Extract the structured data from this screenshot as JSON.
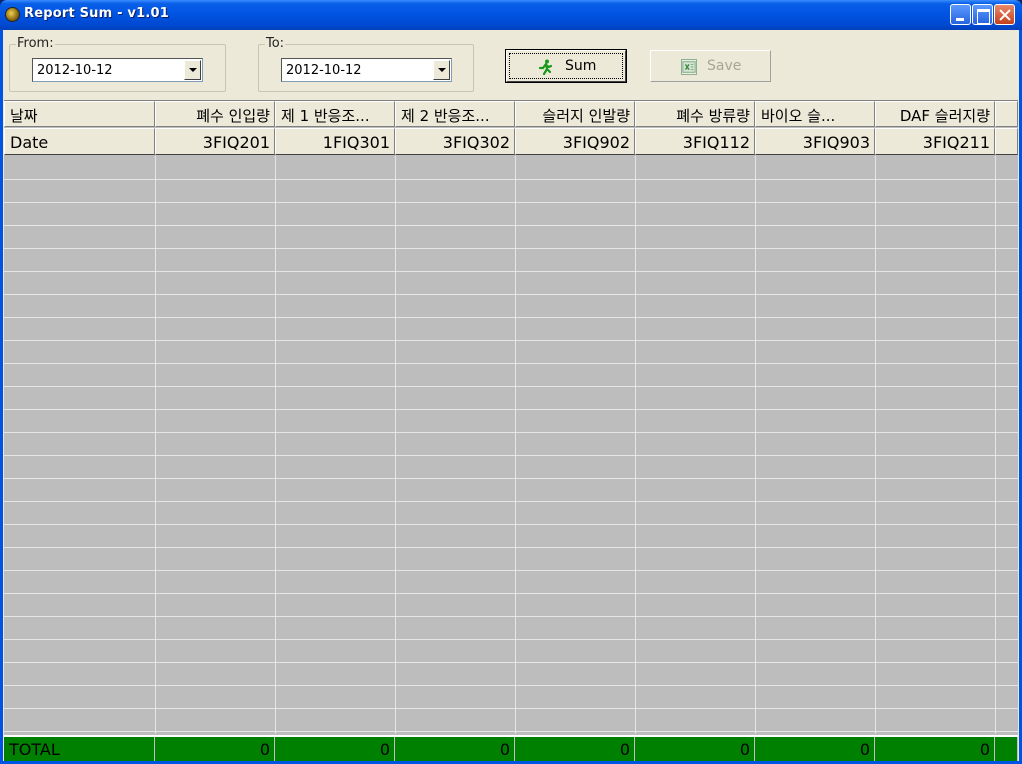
{
  "window": {
    "title": "Report Sum - v1.01",
    "icon": "app-icon",
    "controls": [
      "minimize-icon",
      "maximize-icon",
      "close-icon"
    ]
  },
  "filters": {
    "from": {
      "label": "From:",
      "value": "2012-10-12"
    },
    "to": {
      "label": "To:",
      "value": "2012-10-12"
    }
  },
  "buttons": {
    "sum": {
      "label": "Sum",
      "icon": "running-man-icon"
    },
    "save": {
      "label": "Save",
      "icon": "excel-icon",
      "enabled": false
    }
  },
  "table": {
    "columns": [
      {
        "header": "날짜",
        "code": "Date"
      },
      {
        "header": "폐수 인입량",
        "code": "3FIQ201"
      },
      {
        "header": "제 1 반응조...",
        "code": "1FIQ301"
      },
      {
        "header": "제 2 반응조...",
        "code": "3FIQ302"
      },
      {
        "header": "슬러지 인발량",
        "code": "3FIQ902"
      },
      {
        "header": "폐수 방류량",
        "code": "3FIQ112"
      },
      {
        "header": "바이오 슬...",
        "code": "3FIQ903"
      },
      {
        "header": "DAF 슬러지량",
        "code": "3FIQ211"
      }
    ],
    "total_label": "TOTAL",
    "totals": [
      "0",
      "0",
      "0",
      "0",
      "0",
      "0",
      "0"
    ]
  },
  "colors": {
    "title_bar": "#0054e3",
    "window_bg": "#ece9d8",
    "grid_bg": "#bdbdbd",
    "total_row": "#008000"
  }
}
